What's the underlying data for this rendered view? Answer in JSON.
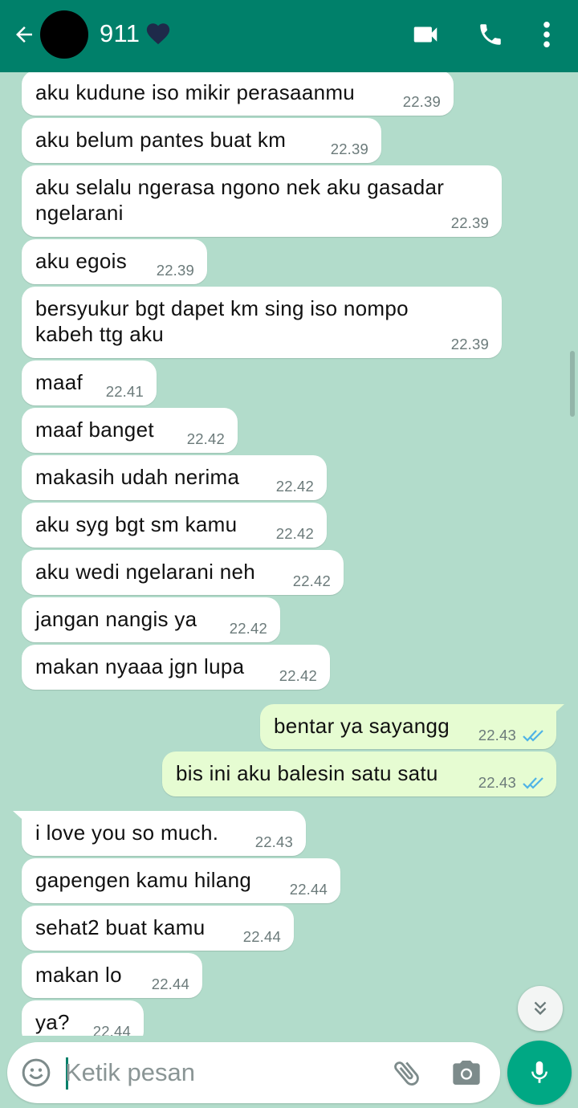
{
  "header": {
    "contact_name": "911",
    "heart_color": "#1e2a4a",
    "bar_color": "#00806a",
    "icons": [
      "back-arrow-icon",
      "video-call-icon",
      "phone-call-icon",
      "more-options-icon"
    ]
  },
  "messages": [
    {
      "dir": "in",
      "text": "aku kudune iso mikir perasaanmu",
      "time": "22.39"
    },
    {
      "dir": "in",
      "text": "aku belum pantes buat km",
      "time": "22.39"
    },
    {
      "dir": "in",
      "text": "aku selalu ngerasa ngono nek aku gasadar ngelarani",
      "time": "22.39"
    },
    {
      "dir": "in",
      "text": "aku egois",
      "time": "22.39"
    },
    {
      "dir": "in",
      "text": "bersyukur bgt dapet km sing iso nompo kabeh ttg aku",
      "time": "22.39"
    },
    {
      "dir": "in",
      "text": "maaf",
      "time": "22.41"
    },
    {
      "dir": "in",
      "text": "maaf banget",
      "time": "22.42"
    },
    {
      "dir": "in",
      "text": "makasih udah nerima",
      "time": "22.42"
    },
    {
      "dir": "in",
      "text": "aku syg bgt sm kamu",
      "time": "22.42"
    },
    {
      "dir": "in",
      "text": "aku wedi ngelarani neh",
      "time": "22.42"
    },
    {
      "dir": "in",
      "text": "jangan nangis ya",
      "time": "22.42"
    },
    {
      "dir": "in",
      "text": "makan nyaaa jgn lupa",
      "time": "22.42"
    },
    {
      "dir": "out",
      "text": "bentar ya sayangg",
      "time": "22.43",
      "status": "read"
    },
    {
      "dir": "out",
      "text": "bis ini aku balesin satu satu",
      "time": "22.43",
      "status": "read"
    },
    {
      "dir": "in",
      "text": "i love you so much.",
      "time": "22.43"
    },
    {
      "dir": "in",
      "text": "gapengen kamu hilang",
      "time": "22.44"
    },
    {
      "dir": "in",
      "text": "sehat2 buat kamu",
      "time": "22.44"
    },
    {
      "dir": "in",
      "text": "makan lo",
      "time": "22.44"
    },
    {
      "dir": "in",
      "text": "ya?",
      "time": "22.44"
    }
  ],
  "composer": {
    "placeholder": "Ketik pesan",
    "icons": [
      "emoji-icon",
      "attach-icon",
      "camera-icon",
      "mic-icon"
    ]
  },
  "colors": {
    "chat_background": "#b2dccb",
    "incoming_bubble": "#ffffff",
    "outgoing_bubble": "#e6fcd2",
    "read_ticks": "#4fb3e6",
    "mic_button": "#00a884"
  }
}
